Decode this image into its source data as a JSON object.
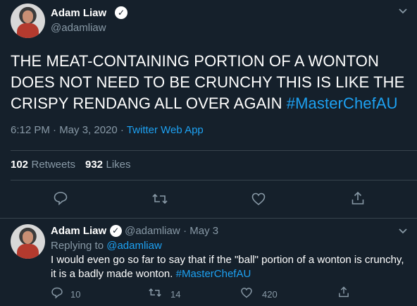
{
  "tweet": {
    "name": "Adam Liaw",
    "handle": "@adamliaw",
    "text_parts": [
      "THE MEAT-CONTAINING PORTION OF A WONTON",
      "DOES NOT NEED TO BE CRUNCHY THIS IS LIKE THE",
      "CRISPY RENDANG ALL OVER AGAIN "
    ],
    "hashtag": "#MasterChefAU",
    "time": "6:12 PM · May 3, 2020 · ",
    "source": "Twitter Web App",
    "retweets_count": "102",
    "retweets_label": "Retweets",
    "likes_count": "932",
    "likes_label": "Likes"
  },
  "reply": {
    "name": "Adam Liaw",
    "handle": "@adamliaw",
    "date": "· May 3",
    "replying_prefix": "Replying to ",
    "replying_handle": "@adamliaw",
    "line1": "I would even go so far to say that if the \"ball\" portion of a wonton is crunchy,",
    "line2": "it is a badly made wonton. ",
    "hashtag": "#MasterChefAU",
    "reply_count": "10",
    "retweet_count": "14",
    "like_count": "420"
  },
  "icons": {
    "verified": "verified-badge-icon",
    "chevron": "chevron-down-icon",
    "reply": "reply-icon",
    "retweet": "retweet-icon",
    "like": "like-icon",
    "share": "share-icon"
  },
  "colors": {
    "background": "#15202b",
    "link": "#1da1f2",
    "secondary_text": "#8899a6",
    "divider": "#38444d"
  }
}
